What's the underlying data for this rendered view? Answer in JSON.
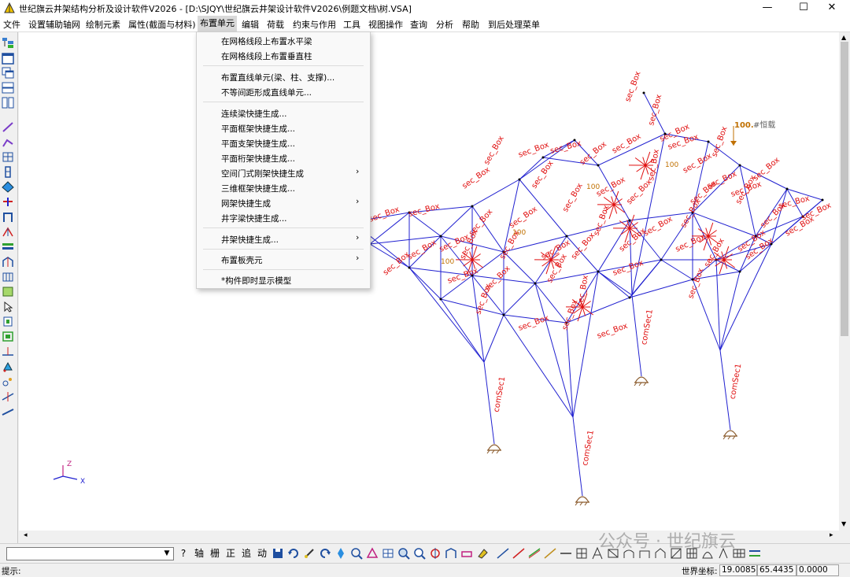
{
  "window": {
    "title": "世纪旗云井架结构分析及设计软件V2026  - [D:\\SJQY\\世纪旗云井架设计软件V2026\\例题文档\\树.VSA]",
    "minimize": "—",
    "maximize": "☐",
    "close": "✕"
  },
  "menubar": {
    "items": [
      "文件",
      "设置辅助轴网",
      "绘制元素",
      "属性(截面与材料)",
      "布置单元",
      "编辑",
      "荷载",
      "约束与作用",
      "工具",
      "视图操作",
      "查询",
      "分析",
      "帮助",
      "到后处理菜单"
    ],
    "active": "布置单元"
  },
  "dropdown": {
    "items": [
      {
        "label": "在网格线段上布置水平梁"
      },
      {
        "label": "在网格线段上布置垂直柱"
      },
      {
        "label": "布置直线单元(梁、柱、支撑)..."
      },
      {
        "label": "不等间距形成直线单元..."
      },
      {
        "label": "连续梁快捷生成..."
      },
      {
        "label": "平面框架快捷生成..."
      },
      {
        "label": "平面支架快捷生成..."
      },
      {
        "label": "平面桁架快捷生成..."
      },
      {
        "label": "空间门式刚架快捷生成",
        "submenu": "›"
      },
      {
        "label": "三维框架快捷生成..."
      },
      {
        "label": "网架快捷生成",
        "submenu": "›"
      },
      {
        "label": "井字梁快捷生成..."
      },
      {
        "label": "井架快捷生成...",
        "submenu": "›"
      },
      {
        "label": "布置板壳元",
        "submenu": "›"
      },
      {
        "label": "*构件即时显示模型"
      }
    ]
  },
  "canvas": {
    "section_label": "sec_Box",
    "column_label": "comSec1",
    "load_value": "100.",
    "load_case": "#恒载",
    "axis_z": "Z",
    "axis_x": "X",
    "small_loads": [
      "100",
      "100",
      "100",
      "100"
    ],
    "colors": {
      "members": "#2020d0",
      "labels": "#e01010",
      "load": "#c07000",
      "support": "#8a5a2b"
    }
  },
  "bottombar": {
    "text_buttons": [
      "?",
      "轴",
      "栅",
      "正",
      "追",
      "动"
    ]
  },
  "statusbar": {
    "hint": "提示:",
    "coord_label": "世界坐标:",
    "x": "19.0085",
    "y": "65.4435",
    "z": "0.0000"
  },
  "watermark": "公众号 · 世纪旗云"
}
